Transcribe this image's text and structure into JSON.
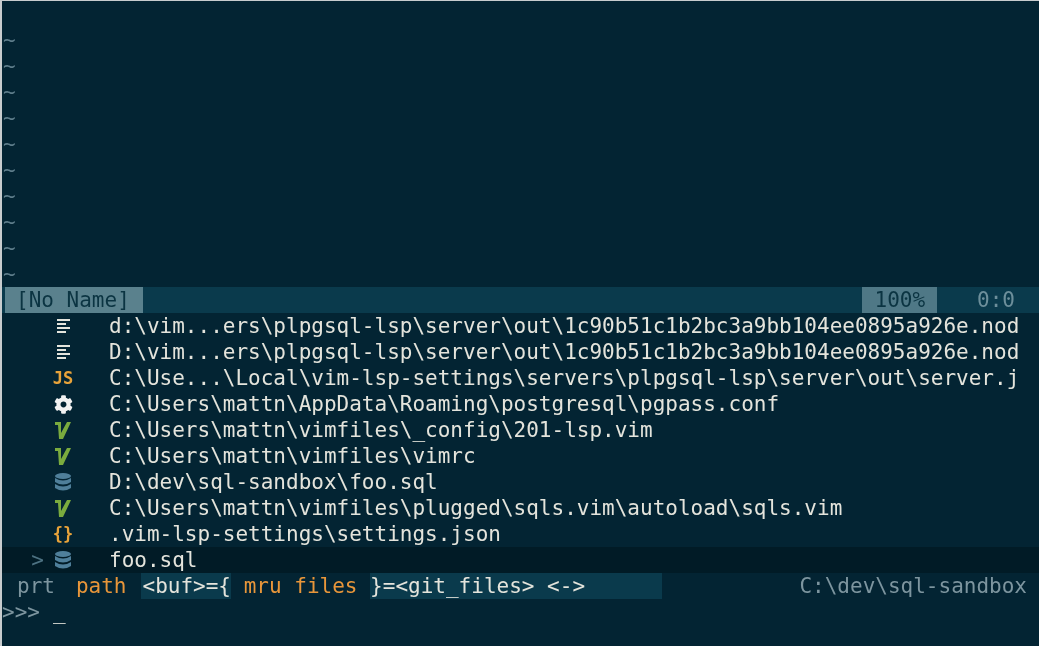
{
  "editor": {
    "empty_lines": [
      "~",
      "~",
      "~",
      "~",
      "~",
      "~",
      "~",
      "~",
      "~",
      "~"
    ]
  },
  "status_line": {
    "file": "[No Name]",
    "percent": "100%",
    "position": "0:0"
  },
  "results": [
    {
      "kind": "text",
      "path": "d:\\vim...ers\\plpgsql-lsp\\server\\out\\1c90b51c1b2bc3a9bb104ee0895a926e.nod",
      "selected": false
    },
    {
      "kind": "text",
      "path": "D:\\vim...ers\\plpgsql-lsp\\server\\out\\1c90b51c1b2bc3a9bb104ee0895a926e.nod",
      "selected": false
    },
    {
      "kind": "js",
      "glyph": "JS",
      "path": "C:\\Use...\\Local\\vim-lsp-settings\\servers\\plpgsql-lsp\\server\\out\\server.j",
      "selected": false
    },
    {
      "kind": "gear",
      "path": "C:\\Users\\mattn\\AppData\\Roaming\\postgresql\\pgpass.conf",
      "selected": false
    },
    {
      "kind": "vim",
      "path": "C:\\Users\\mattn\\vimfiles\\_config\\201-lsp.vim",
      "selected": false
    },
    {
      "kind": "vim",
      "path": "C:\\Users\\mattn\\vimfiles\\vimrc",
      "selected": false
    },
    {
      "kind": "database",
      "path": "D:\\dev\\sql-sandbox\\foo.sql",
      "selected": false
    },
    {
      "kind": "vim",
      "path": "C:\\Users\\mattn\\vimfiles\\plugged\\sqls.vim\\autoload\\sqls.vim",
      "selected": false
    },
    {
      "kind": "json",
      "glyph": "{}",
      "path": ".vim-lsp-settings\\settings.json",
      "selected": false
    },
    {
      "kind": "database",
      "path": "foo.sql",
      "selected": true,
      "marker": ">"
    }
  ],
  "ctrlp_status": {
    "mode": "prt",
    "match": "path",
    "modes_before": "<buf>={",
    "current_mode": " mru files ",
    "modes_after": "}=<git_files> <->",
    "cwd": "C:\\dev\\sql-sandbox"
  },
  "prompt": {
    "symbol": ">>>",
    "cursor": "_"
  }
}
